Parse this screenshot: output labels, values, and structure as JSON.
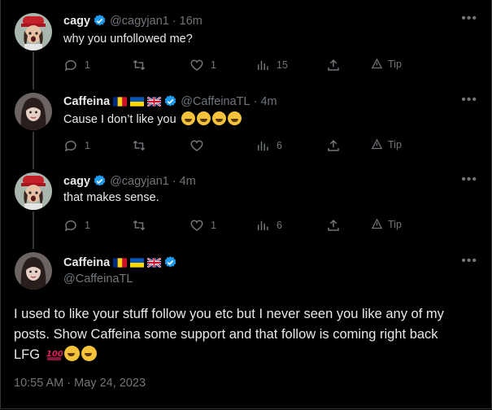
{
  "tweets": [
    {
      "name": "cagy",
      "handle": "@cagyjan1",
      "time": "16m",
      "separator": "·",
      "text": "why you unfollowed me?",
      "reply_count": "1",
      "retweet_count": "",
      "like_count": "1",
      "view_count": "15",
      "tip_label": "Tip"
    },
    {
      "name": "Caffeina",
      "handle": "@CaffeinaTL",
      "time": "4m",
      "separator": "·",
      "text": "Cause I don’t like you",
      "emojis": [
        "rolling-laughing",
        "laughing-tears",
        "rolling-laughing",
        "rolling-laughing"
      ],
      "reply_count": "1",
      "retweet_count": "",
      "like_count": "",
      "view_count": "6",
      "tip_label": "Tip"
    },
    {
      "name": "cagy",
      "handle": "@cagyjan1",
      "time": "4m",
      "separator": "·",
      "text": "that makes sense.",
      "reply_count": "1",
      "retweet_count": "",
      "like_count": "1",
      "view_count": "6",
      "tip_label": "Tip"
    }
  ],
  "main_tweet": {
    "name": "Caffeina",
    "handle": "@CaffeinaTL",
    "text_line1": "I used to like your stuff follow you etc  but I never seen you like any of my",
    "text_line2": "posts. Show Caffeina some support and that follow is coming right back",
    "text_line3": "LFG",
    "timestamp": "10:55 AM · May 24, 2023"
  },
  "icons": {
    "reply": "reply-icon",
    "retweet": "retweet-icon",
    "like": "heart-icon",
    "views": "views-icon",
    "share": "share-icon",
    "tip": "tip-icon",
    "verified": "verified-badge-icon",
    "more": "more-icon"
  },
  "colors": {
    "background": "#000000",
    "text": "#e7e9ea",
    "muted": "#71767b",
    "verified": "#1d9bf0"
  }
}
